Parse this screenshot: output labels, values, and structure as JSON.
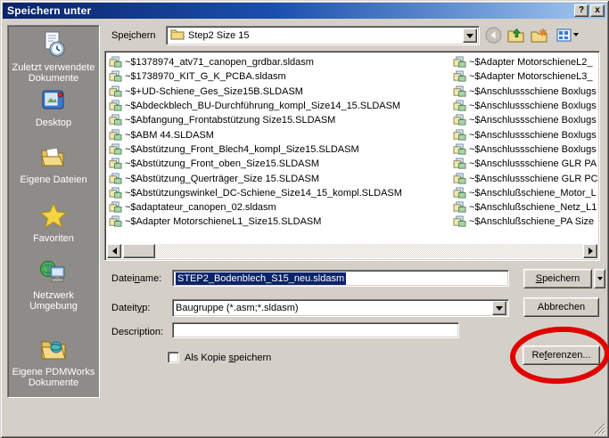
{
  "window": {
    "title": "Speichern unter",
    "help_button": "?",
    "close_button": "x"
  },
  "toolbar": {
    "save_in_label": {
      "pre": "Spe",
      "accel": "i",
      "post": "chern"
    },
    "location_value": "Step2 Size 15"
  },
  "places": {
    "items": [
      {
        "icon": "recent-documents-icon",
        "label": "Zuletzt verwendete Dokumente"
      },
      {
        "icon": "desktop-icon",
        "label": "Desktop"
      },
      {
        "icon": "my-documents-icon",
        "label": "Eigene Dateien"
      },
      {
        "icon": "favorites-icon",
        "label": "Favoriten"
      },
      {
        "icon": "network-icon",
        "label": "Netzwerk Umgebung"
      },
      {
        "icon": "pdmworks-icon",
        "label": "Eigene PDMWorks Dokumente"
      }
    ]
  },
  "file_list": {
    "left_column": [
      "~$1378974_atv71_canopen_grdbar.sldasm",
      "~$1738970_KIT_G_K_PCBA.sldasm",
      "~$+UD-Schiene_Ges_Size15B.SLDASM",
      "~$Abdeckblech_BU-Durchführung_kompl_Size14_15.SLDASM",
      "~$Abfangung_Frontabstützung Size15.SLDASM",
      "~$ABM 44.SLDASM",
      "~$Abstützung_Front_Blech4_kompl_Size15.SLDASM",
      "~$Abstützung_Front_oben_Size15.SLDASM",
      "~$Abstützung_Querträger_Size 15.SLDASM",
      "~$Abstützungswinkel_DC-Schiene_Size14_15_kompl.SLDASM",
      "~$adaptateur_canopen_02.sldasm",
      "~$Adapter MotorschieneL1_Size15.SLDASM"
    ],
    "right_column": [
      "~$Adapter MotorschieneL2_",
      "~$Adapter MotorschieneL3_",
      "~$Anschlussschiene Boxlugs",
      "~$Anschlussschiene Boxlugs",
      "~$Anschlussschiene Boxlugs",
      "~$Anschlussschiene Boxlugs",
      "~$Anschlussschiene Boxlugs",
      "~$Anschlussschiene GLR PA",
      "~$Anschlussschiene GLR PC",
      "~$Anschlußschiene_Motor_L",
      "~$Anschlußschiene_Netz_L1",
      "~$Anschlußschiene_PA Size"
    ]
  },
  "form": {
    "filename_label": {
      "pre": "Datei",
      "accel": "n",
      "post": "ame:"
    },
    "filename_value": "STEP2_Bodenblech_S15_neu.sldasm",
    "filetype_label": {
      "pre": "Dateit",
      "accel": "y",
      "post": "p:"
    },
    "filetype_value": "Baugruppe (*.asm;*.sldasm)",
    "description_label": "Description:",
    "description_value": "",
    "copy_checkbox_label": {
      "pre": "Als Kopie ",
      "accel": "s",
      "post": "peichern"
    }
  },
  "buttons": {
    "save": {
      "pre": "",
      "accel": "S",
      "post": "peichern"
    },
    "cancel": "Abbrechen",
    "references": {
      "pre": "Re",
      "accel": "f",
      "post": "erenzen..."
    }
  },
  "colors": {
    "dialog_bg": "#d4d0c8",
    "titlebar_left": "#0a246a",
    "titlebar_right": "#a6caf0",
    "places_bg": "#8e8c88",
    "selection": "#0a246a",
    "annotation_red": "#e00000"
  }
}
